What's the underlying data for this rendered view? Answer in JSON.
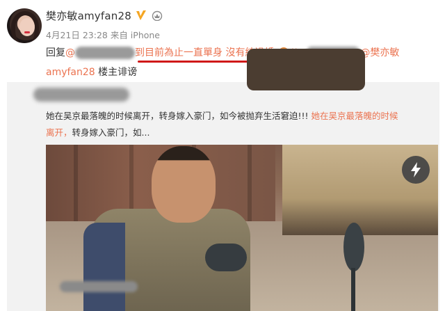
{
  "post": {
    "username": "樊亦敏amyfan28",
    "meta": "4月21日 23:28 来自 iPhone",
    "reply": {
      "prefix": "回复",
      "at": "@",
      "highlight": "到目前為止一直單身 沒有結過婚",
      "separator": "//@",
      "mention_tail": "@樊亦敏",
      "line2_mention": "amyfan28",
      "line2_text": " 楼主诽谤"
    }
  },
  "repost": {
    "text_line1": "她在吴京最落魄的时候离开，转身嫁入豪门，如今被抛弃生活窘迫!!!",
    "quote_line1": " 她在吴京最落魄的时候",
    "quote_line2": "离开，",
    "text_line2": "转身嫁入豪门，如..."
  },
  "colors": {
    "mention": "#eb7350",
    "underline": "#d01818",
    "verified": "#f5a623"
  },
  "icons": [
    "verified-v-icon",
    "crown-icon",
    "flash-icon"
  ]
}
